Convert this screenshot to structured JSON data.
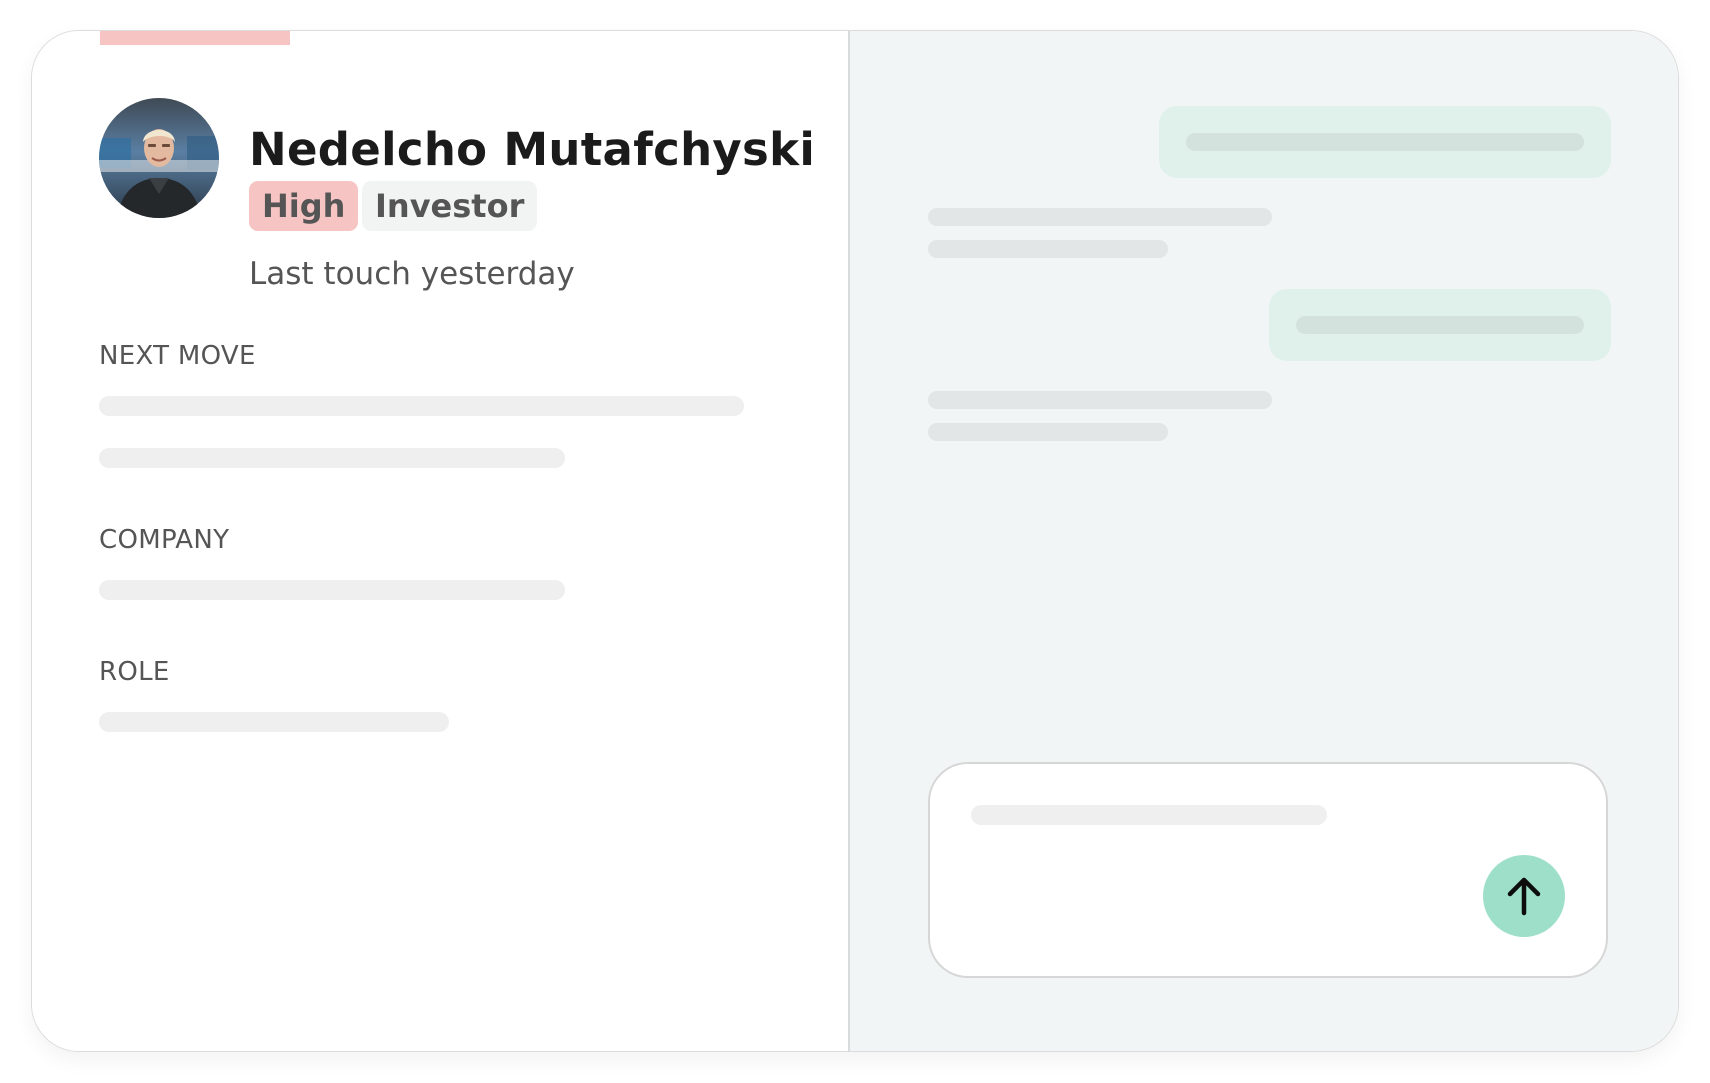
{
  "contact": {
    "name": "Nedelcho Mutafchyski",
    "priority_tag": "High",
    "type_tag": "Investor",
    "last_touch": "Last touch yesterday",
    "avatar_icon": "person-photo"
  },
  "details": {
    "next_move_label": "NEXT MOVE",
    "company_label": "COMPANY",
    "role_label": "ROLE"
  },
  "colors": {
    "priority_accent": "#f7c4c4",
    "investor_tag_bg": "#f2f4f4",
    "chat_pane_bg": "#f2f5f5",
    "outgoing_bubble": "#dff1ea",
    "send_button": "#9ddfc8"
  },
  "composer": {
    "send_icon": "arrow-up-icon"
  }
}
